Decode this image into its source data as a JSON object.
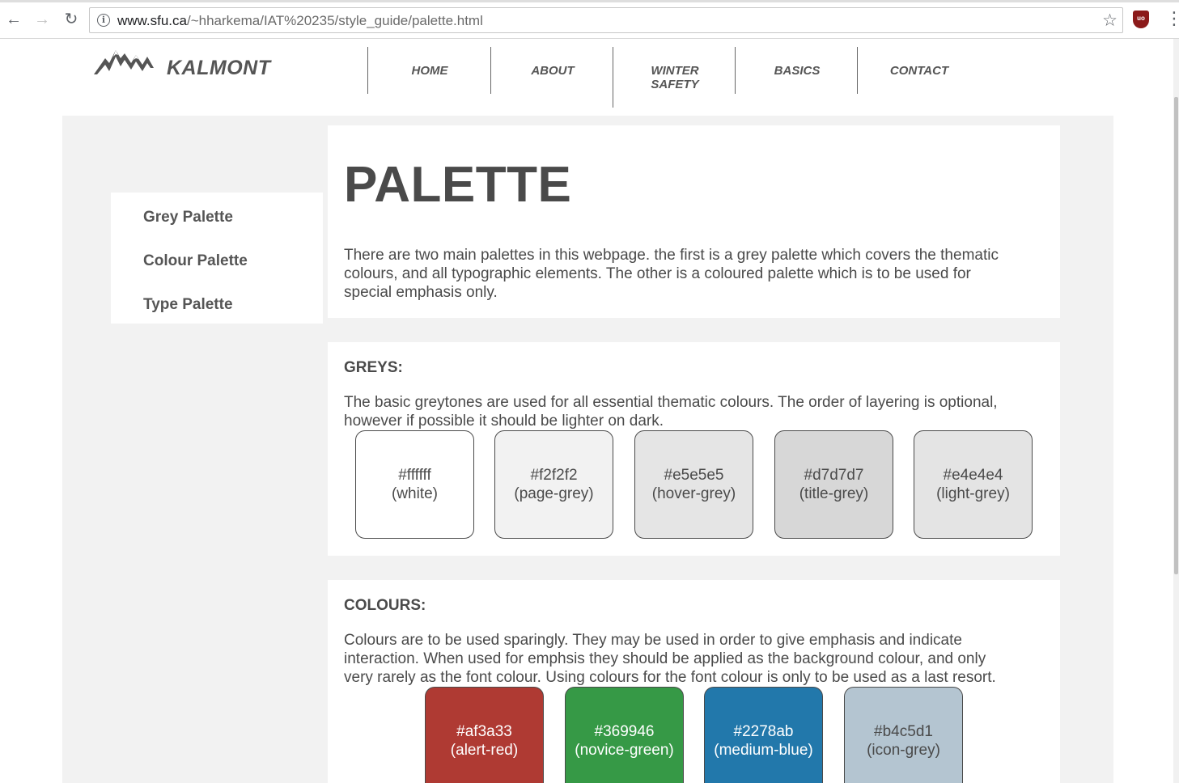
{
  "browser": {
    "url_host": "www.sfu.ca",
    "url_path": "/~hharkema/IAT%20235/style_guide/palette.html",
    "back_icon": "back-arrow-icon",
    "forward_icon": "forward-arrow-icon",
    "reload_icon": "reload-icon",
    "info_icon": "info-icon",
    "bookmark_icon": "star-icon",
    "extension_label": "uo",
    "menu_icon": "vertical-dots-icon"
  },
  "header": {
    "brand": "KALMONT",
    "logo_icon": "mountain-logo-icon",
    "nav": [
      {
        "label": "HOME"
      },
      {
        "label": "ABOUT"
      },
      {
        "label_line1": "WINTER",
        "label_line2": "SAFETY"
      },
      {
        "label": "BASICS"
      },
      {
        "label": "CONTACT"
      }
    ]
  },
  "sidebar": {
    "items": [
      {
        "label": "Grey Palette"
      },
      {
        "label": "Colour Palette"
      },
      {
        "label": "Type Palette"
      }
    ]
  },
  "intro": {
    "title": "PALETTE",
    "text_lines": [
      "There are two main palettes in this webpage. the first is a grey palette which covers the thematic",
      "colours, and all typographic elements. The other is a coloured palette which is to be used for",
      "special emphasis only."
    ]
  },
  "greys": {
    "heading": "GREYS:",
    "text_lines": [
      "The basic greytones are used for all essential thematic colours. The order of layering is optional,",
      "however if possible it should be lighter on dark."
    ],
    "swatches": [
      {
        "code": "#ffffff",
        "name": "(white)",
        "color": "#ffffff"
      },
      {
        "code": "#f2f2f2",
        "name": "(page-grey)",
        "color": "#f2f2f2"
      },
      {
        "code": "#e5e5e5",
        "name": "(hover-grey)",
        "color": "#e5e5e5"
      },
      {
        "code": "#d7d7d7",
        "name": "(title-grey)",
        "color": "#d7d7d7"
      },
      {
        "code": "#e4e4e4",
        "name": "(light-grey)",
        "color": "#e4e4e4"
      }
    ]
  },
  "colours": {
    "heading": "COLOURS:",
    "text_lines": [
      "Colours are to be used sparingly. They may be used in order to give emphasis and indicate",
      "interaction. When used for emphsis they should be applied as the background colour, and only",
      "very rarely as the font colour. Using colours for the font colour is only to be used as a last resort."
    ],
    "swatches": [
      {
        "code": "#af3a33",
        "name": "(alert-red)",
        "color": "#af3a33"
      },
      {
        "code": "#369946",
        "name": "(novice-green)",
        "color": "#369946"
      },
      {
        "code": "#2278ab",
        "name": "(medium-blue)",
        "color": "#2278ab"
      },
      {
        "code": "#b4c5d1",
        "name": "(icon-grey)",
        "color": "#b4c5d1"
      }
    ]
  }
}
